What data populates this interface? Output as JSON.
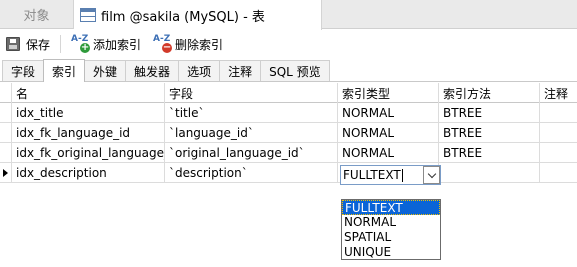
{
  "tabs": {
    "objects": "对象",
    "active": "film @sakila (MySQL) - 表"
  },
  "toolbar": {
    "save": "保存",
    "add_index": "添加索引",
    "delete_index": "删除索引",
    "az": "A-Z"
  },
  "subtabs": [
    "字段",
    "索引",
    "外键",
    "触发器",
    "选项",
    "注释",
    "SQL 预览"
  ],
  "active_subtab": "索引",
  "columns": [
    "名",
    "字段",
    "索引类型",
    "索引方法",
    "注释"
  ],
  "rows": [
    {
      "name": "idx_title",
      "field": "`title`",
      "type": "NORMAL",
      "method": "BTREE",
      "comment": ""
    },
    {
      "name": "idx_fk_language_id",
      "field": "`language_id`",
      "type": "NORMAL",
      "method": "BTREE",
      "comment": ""
    },
    {
      "name": "idx_fk_original_language_id",
      "field": "`original_language_id`",
      "type": "NORMAL",
      "method": "BTREE",
      "comment": ""
    },
    {
      "name": "idx_description",
      "field": "`description`",
      "type": "FULLTEXT",
      "method": "",
      "comment": ""
    }
  ],
  "dropdown": {
    "current": "FULLTEXT",
    "options": [
      "FULLTEXT",
      "NORMAL",
      "SPATIAL",
      "UNIQUE"
    ],
    "selected": "FULLTEXT"
  },
  "colors": {
    "selection": "#0a64d7",
    "add_badge": "#2e9a3a",
    "delete_badge": "#d23a2a"
  }
}
